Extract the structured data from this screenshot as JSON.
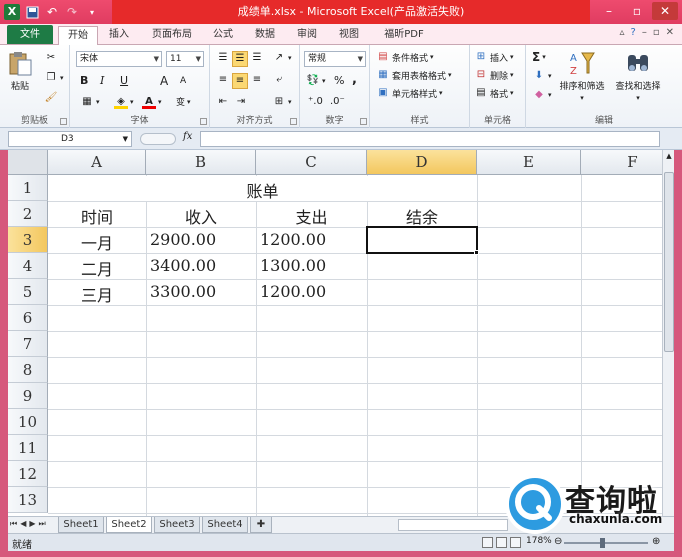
{
  "window": {
    "title": "成绩单.xlsx - Microsoft Excel(产品激活失败)",
    "colors": {
      "titlebar": "#e62a2a",
      "file_tab": "#1e7b45",
      "frame": "#d6587c"
    }
  },
  "tabs": {
    "file": "文件",
    "items": [
      "开始",
      "插入",
      "页面布局",
      "公式",
      "数据",
      "审阅",
      "视图",
      "福昕PDF"
    ],
    "active": "开始"
  },
  "ribbon": {
    "clipboard": {
      "label": "剪贴板",
      "paste": "粘贴"
    },
    "font": {
      "label": "字体",
      "name": "宋体",
      "size": "11",
      "bold": "B",
      "italic": "I",
      "underline": "U",
      "grow": "A",
      "shrink": "A",
      "phonetic": "变"
    },
    "align": {
      "label": "对齐方式"
    },
    "number": {
      "label": "数字",
      "format": "常规",
      "percent": "%",
      "comma": ","
    },
    "styles": {
      "label": "样式",
      "conditional": "条件格式",
      "table": "套用表格格式",
      "cell": "单元格样式"
    },
    "cells": {
      "label": "单元格",
      "insert": "插入",
      "delete": "删除",
      "format": "格式"
    },
    "editing": {
      "label": "编辑",
      "sort": "排序和筛选",
      "find": "查找和选择",
      "sum": "Σ"
    }
  },
  "formula_bar": {
    "name_box": "D3",
    "fx": "fx",
    "value": ""
  },
  "grid": {
    "columns": [
      "A",
      "B",
      "C",
      "D",
      "E",
      "F"
    ],
    "rows": [
      "1",
      "2",
      "3",
      "4",
      "5",
      "6",
      "7",
      "8",
      "9",
      "10",
      "11",
      "12",
      "13"
    ],
    "active_cell": "D3",
    "cells": {
      "title": "账单",
      "header": [
        "时间",
        "收入",
        "支出",
        "结余"
      ],
      "data": [
        [
          "一月",
          "2900.00",
          "1200.00"
        ],
        [
          "二月",
          "3400.00",
          "1300.00"
        ],
        [
          "三月",
          "3300.00",
          "1200.00"
        ]
      ]
    }
  },
  "sheets": {
    "items": [
      "Sheet1",
      "Sheet2",
      "Sheet3",
      "Sheet4"
    ],
    "active": "Sheet2"
  },
  "status": {
    "ready": "就绪",
    "zoom": "178%"
  },
  "watermark": {
    "text": "查询啦",
    "url": "chaxunla.com"
  }
}
